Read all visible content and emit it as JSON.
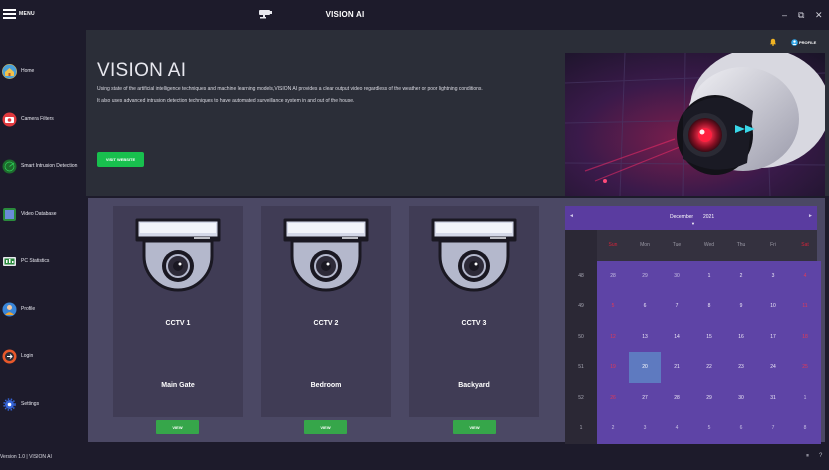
{
  "titlebar": {
    "menu_label": "MENU",
    "title": "VISION AI",
    "minimize": "–",
    "maximize": "⧉",
    "close": "✕"
  },
  "sidebar": {
    "items": [
      {
        "label": "Home",
        "icon": "home-icon"
      },
      {
        "label": "Camera Filters",
        "icon": "camera-filter-icon"
      },
      {
        "label": "Smart Intrusion Detection",
        "icon": "radar-icon"
      },
      {
        "label": "Video Database",
        "icon": "video-database-icon"
      },
      {
        "label": "PC Statistics",
        "icon": "pc-statistics-icon"
      },
      {
        "label": "Profile",
        "icon": "profile-icon"
      },
      {
        "label": "Login",
        "icon": "login-icon"
      },
      {
        "label": "Settings",
        "icon": "settings-icon"
      }
    ]
  },
  "header": {
    "profile_label": "PROFILE"
  },
  "hero": {
    "title": "VISION AI",
    "line1": "Using state of the artificial intelligence techniques and machine learning models,VISION AI provides a clear output video regardless of the weather or poor lightning conditions.",
    "line2": "It also uses advanced intrusion detection techniques to have automated surveillance system in and out of the house.",
    "button_label": "VISIT WEBSITE"
  },
  "cameras": [
    {
      "name": "CCTV 1",
      "location": "Main Gate",
      "button_label": "VIEW"
    },
    {
      "name": "CCTV 2",
      "location": "Bedroom",
      "button_label": "VIEW"
    },
    {
      "name": "CCTV 3",
      "location": "Backyard",
      "button_label": "VIEW"
    }
  ],
  "calendar": {
    "month": "December",
    "year": "2021",
    "prev": "◄",
    "next": "►",
    "weekdays": [
      "Sun",
      "Mon",
      "Tue",
      "Wed",
      "Thu",
      "Fri",
      "Sat"
    ],
    "weeks": [
      {
        "num": "48",
        "days": [
          "28",
          "29",
          "30",
          "1",
          "2",
          "3",
          "4"
        ]
      },
      {
        "num": "49",
        "days": [
          "5",
          "6",
          "7",
          "8",
          "9",
          "10",
          "11"
        ]
      },
      {
        "num": "50",
        "days": [
          "12",
          "13",
          "14",
          "15",
          "16",
          "17",
          "18"
        ]
      },
      {
        "num": "51",
        "days": [
          "19",
          "20",
          "21",
          "22",
          "23",
          "24",
          "25"
        ]
      },
      {
        "num": "52",
        "days": [
          "26",
          "27",
          "28",
          "29",
          "30",
          "31",
          "1"
        ]
      },
      {
        "num": "1",
        "days": [
          "2",
          "3",
          "4",
          "5",
          "6",
          "7",
          "8"
        ]
      }
    ],
    "today": "20",
    "colors": {
      "header": "#5a3ca0",
      "day": "#5e44a6",
      "today": "#5e7ac0",
      "weekend": "#d4233a"
    }
  },
  "statusbar": {
    "text": "Version 1.0 | VISION AI"
  },
  "colors": {
    "background": "#1d1b2b",
    "hero": "#2b2e38",
    "panel": "#4b4864",
    "card": "#403c55",
    "accent_green": "#18c04e"
  }
}
